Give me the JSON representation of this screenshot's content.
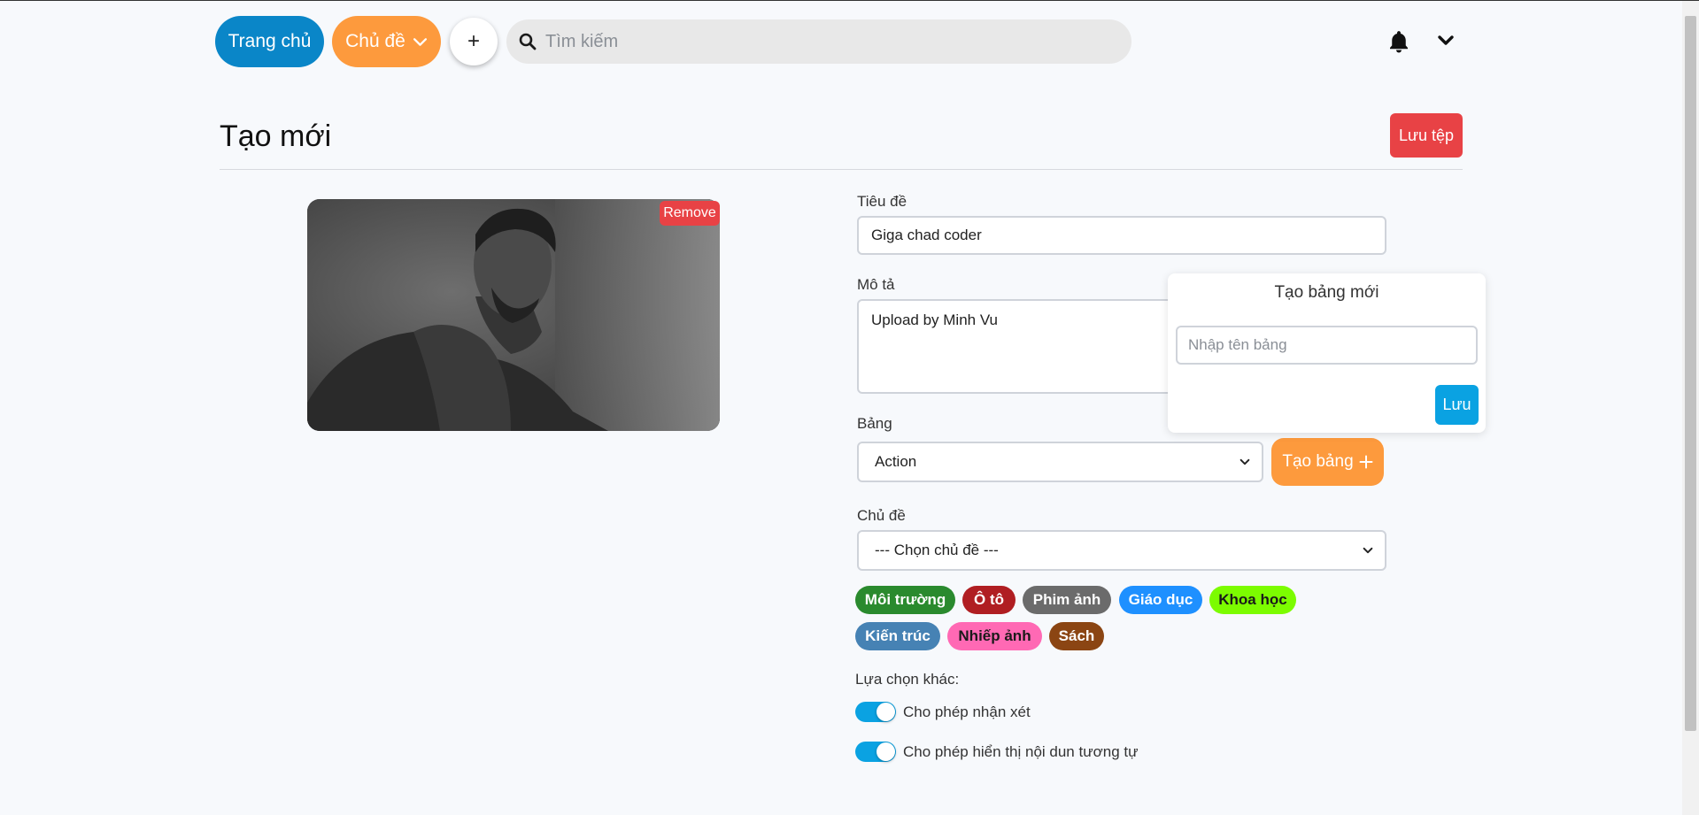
{
  "header": {
    "home_label": "Trang chủ",
    "topic_label": "Chủ đề",
    "plus_symbol": "+",
    "search_placeholder": "Tìm kiếm"
  },
  "page": {
    "title": "Tạo mới",
    "save_file_label": "Lưu tệp"
  },
  "image": {
    "remove_label": "Remove"
  },
  "form": {
    "title_label": "Tiêu đề",
    "title_value": "Giga chad coder",
    "description_label": "Mô tả",
    "description_value": "Upload by Minh Vu",
    "board_label": "Bảng",
    "board_value": "Action",
    "create_board_label": "Tạo bảng",
    "topic_label": "Chủ đề",
    "topic_value": "--- Chọn chủ đề ---",
    "other_options_label": "Lựa chọn khác:"
  },
  "popup": {
    "title": "Tạo bảng mới",
    "input_placeholder": "Nhập tên bảng",
    "save_label": "Lưu"
  },
  "tags": [
    {
      "label": "Môi trường",
      "color": "#2a8a2e",
      "text_color": "#ffffff"
    },
    {
      "label": "Ô tô",
      "color": "#b01e22",
      "text_color": "#ffffff"
    },
    {
      "label": "Phim ảnh",
      "color": "#6b6b6b",
      "text_color": "#ffffff"
    },
    {
      "label": "Giáo dục",
      "color": "#1e90ff",
      "text_color": "#ffffff"
    },
    {
      "label": "Khoa học",
      "color": "#7cfc00",
      "text_color": "#1a1a1a"
    },
    {
      "label": "Kiến trúc",
      "color": "#4682b4",
      "text_color": "#ffffff"
    },
    {
      "label": "Nhiếp ảnh",
      "color": "#ff69b4",
      "text_color": "#1a1a1a"
    },
    {
      "label": "Sách",
      "color": "#8b4513",
      "text_color": "#ffffff"
    }
  ],
  "options": [
    {
      "label": "Cho phép nhận xét",
      "enabled": true
    },
    {
      "label": "Cho phép hiển thị nội dun tương tự",
      "enabled": true
    }
  ],
  "colors": {
    "primary": "#0a86c8",
    "accent": "#fd9a3d",
    "danger": "#e84245",
    "toggle": "#0aa2e2"
  }
}
